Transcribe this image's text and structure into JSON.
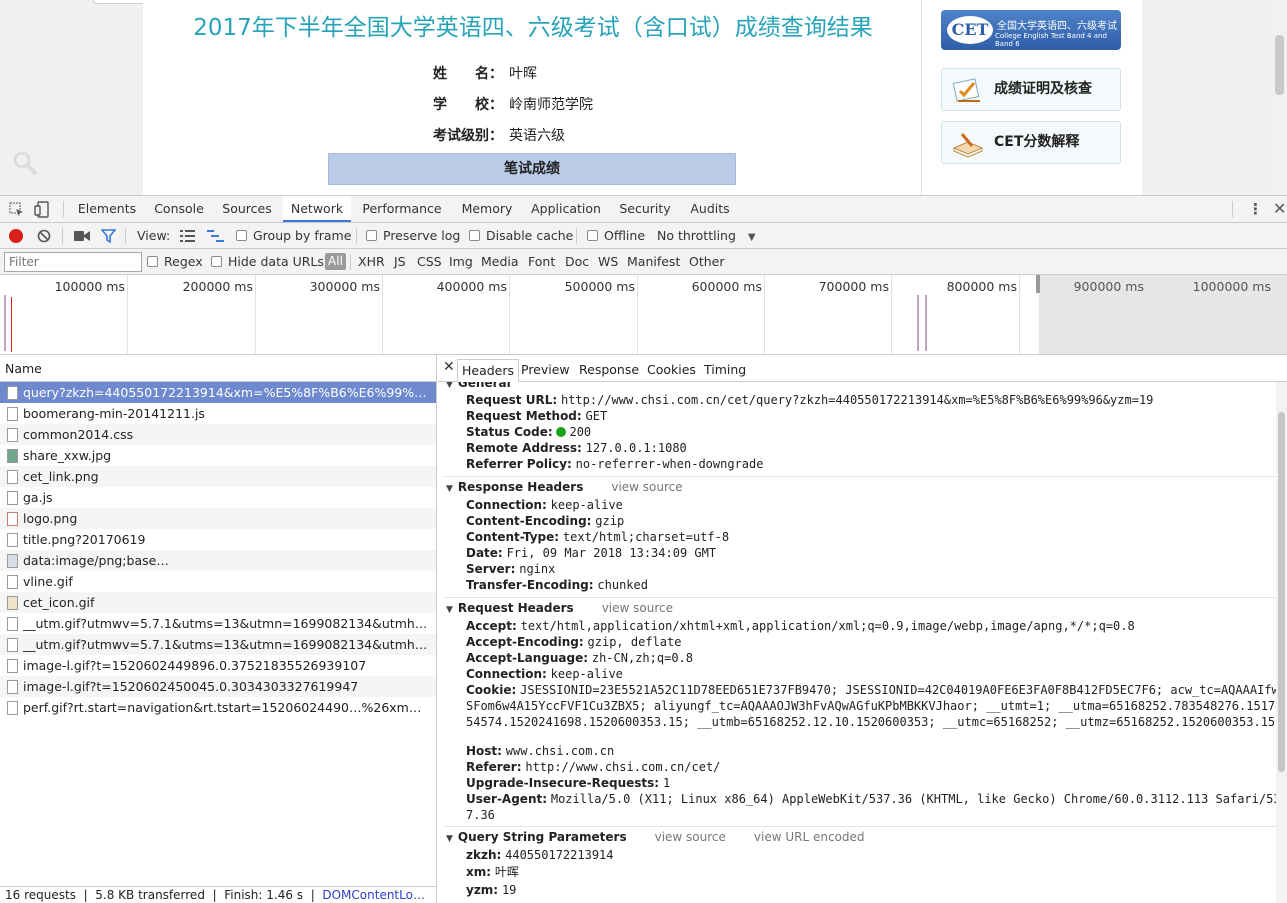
{
  "page": {
    "title": "2017年下半年全国大学英语四、六级考试（含口试）成绩查询结果",
    "fields": [
      {
        "label": "姓　　名：",
        "value": "叶晖"
      },
      {
        "label": "学　　校：",
        "value": "岭南师范学院"
      },
      {
        "label": "考试级别：",
        "value": "英语六级"
      }
    ],
    "written_score_header": "笔试成绩",
    "cet_logo": {
      "mark": "CET",
      "cn": "全国大学英语四、六级考试",
      "en": "College English Test Band 4 and Band 6"
    },
    "side_buttons": [
      "成绩证明及核查",
      "CET分数解释"
    ]
  },
  "devtools": {
    "tabs": [
      "Elements",
      "Console",
      "Sources",
      "Network",
      "Performance",
      "Memory",
      "Application",
      "Security",
      "Audits"
    ],
    "active_tab": "Network",
    "toolbar": {
      "view_label": "View:",
      "group_by_frame": "Group by frame",
      "preserve_log": "Preserve log",
      "disable_cache": "Disable cache",
      "offline": "Offline",
      "throttling": "No throttling"
    },
    "filter_bar": {
      "placeholder": "Filter",
      "regex": "Regex",
      "hide_data_urls": "Hide data URLs",
      "all": "All",
      "types": [
        "XHR",
        "JS",
        "CSS",
        "Img",
        "Media",
        "Font",
        "Doc",
        "WS",
        "Manifest",
        "Other"
      ]
    },
    "overview_ticks": [
      "100000 ms",
      "200000 ms",
      "300000 ms",
      "400000 ms",
      "500000 ms",
      "600000 ms",
      "700000 ms",
      "800000 ms",
      "900000 ms",
      "1000000 ms"
    ],
    "request_list": {
      "header": "Name",
      "rows": [
        "query?zkzh=440550172213914&xm=%E5%8F%B6%E6%99%96&yz…",
        "boomerang-min-20141211.js",
        "common2014.css",
        "share_xxw.jpg",
        "cet_link.png",
        "ga.js",
        "logo.png",
        "title.png?20170619",
        "data:image/png;base…",
        "vline.gif",
        "cet_icon.gif",
        "__utm.gif?utmwv=5.7.1&utms=13&utmn=1699082134&utmh…org…",
        "__utm.gif?utmwv=5.7.1&utms=13&utmn=1699082134&utmh…org…",
        "image-l.gif?t=1520602449896.0.37521835526939107",
        "image-l.gif?t=1520602450045.0.3034303327619947",
        "perf.gif?rt.start=navigation&rt.tstart=15206024490…%26xm%3D…"
      ],
      "status": {
        "requests": "16 requests",
        "transferred": "5.8 KB transferred",
        "finish": "Finish: 1.46 s",
        "dcl": "DOMContentLo…"
      }
    },
    "details": {
      "tabs": [
        "Headers",
        "Preview",
        "Response",
        "Cookies",
        "Timing"
      ],
      "active_tab": "Headers",
      "general": {
        "title": "General",
        "rows": [
          {
            "k": "Request URL:",
            "v": "http://www.chsi.com.cn/cet/query?zkzh=440550172213914&xm=%E5%8F%B6%E6%99%96&yzm=19"
          },
          {
            "k": "Request Method:",
            "v": "GET"
          },
          {
            "k": "Status Code:",
            "v": "200"
          },
          {
            "k": "Remote Address:",
            "v": "127.0.0.1:1080"
          },
          {
            "k": "Referrer Policy:",
            "v": "no-referrer-when-downgrade"
          }
        ]
      },
      "response_headers": {
        "title": "Response Headers",
        "view_source": "view source",
        "rows": [
          {
            "k": "Connection:",
            "v": "keep-alive"
          },
          {
            "k": "Content-Encoding:",
            "v": "gzip"
          },
          {
            "k": "Content-Type:",
            "v": "text/html;charset=utf-8"
          },
          {
            "k": "Date:",
            "v": "Fri, 09 Mar 2018 13:34:09 GMT"
          },
          {
            "k": "Server:",
            "v": "nginx"
          },
          {
            "k": "Transfer-Encoding:",
            "v": "chunked"
          }
        ]
      },
      "request_headers": {
        "title": "Request Headers",
        "view_source": "view source",
        "rows": [
          {
            "k": "Accept:",
            "v": "text/html,application/xhtml+xml,application/xml;q=0.9,image/webp,image/apng,*/*;q=0.8"
          },
          {
            "k": "Accept-Encoding:",
            "v": "gzip, deflate"
          },
          {
            "k": "Accept-Language:",
            "v": "zh-CN,zh;q=0.8"
          },
          {
            "k": "Connection:",
            "v": "keep-alive"
          },
          {
            "k": "Cookie:",
            "v": "JSESSIONID=23E5521A52C11D78EED651E737FB9470; JSESSIONID=42C04019A0FE6E3FA0F8B412FD5EC7F6; acw_tc=AQAAAIfwSFom6w4A15YccFVF1Cu3ZBX5; aliyungf_tc=AQAAAOJW3hFvAQwAGfuKPbMBKKVJhaor; __utmt=1; __utma=65168252.783548276.1517454574.1520241698.1520600353.15; __utmb=65168252.12.10.1520600353; __utmc=65168252; __utmz=65168252.1520600353.15.5.utmcsr=baidu|utmccn=(organic)|utmcmd=organic"
          },
          {
            "k": "Host:",
            "v": "www.chsi.com.cn"
          },
          {
            "k": "Referer:",
            "v": "http://www.chsi.com.cn/cet/"
          },
          {
            "k": "Upgrade-Insecure-Requests:",
            "v": "1"
          },
          {
            "k": "User-Agent:",
            "v": "Mozilla/5.0 (X11; Linux x86_64) AppleWebKit/537.36 (KHTML, like Gecko) Chrome/60.0.3112.113 Safari/537.36"
          }
        ]
      },
      "query_params": {
        "title": "Query String Parameters",
        "view_source": "view source",
        "view_url_encoded": "view URL encoded",
        "rows": [
          {
            "k": "zkzh:",
            "v": "440550172213914"
          },
          {
            "k": "xm:",
            "v": "叶晖"
          },
          {
            "k": "yzm:",
            "v": "19"
          }
        ]
      }
    }
  },
  "colors": {
    "title_teal": "#27a3ba",
    "selected_row": "#6e89cd",
    "active_tab_underline": "#3879d9",
    "record_red": "#d7201a"
  }
}
